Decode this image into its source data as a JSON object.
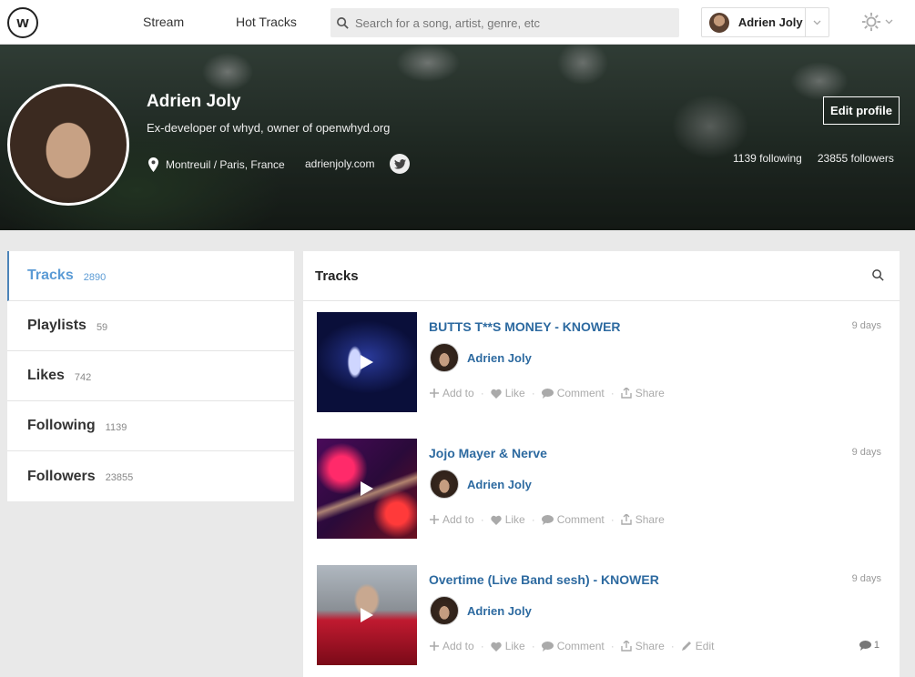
{
  "header": {
    "logo": "w",
    "nav": [
      "Stream",
      "Hot Tracks"
    ],
    "search_placeholder": "Search for a song, artist, genre, etc",
    "user_name": "Adrien Joly"
  },
  "profile": {
    "name": "Adrien Joly",
    "bio": "Ex-developer of whyd, owner of openwhyd.org",
    "location": "Montreuil / Paris, France",
    "website": "adrienjoly.com",
    "edit_label": "Edit profile",
    "following": "1139 following",
    "followers": "23855 followers"
  },
  "sidebar": {
    "items": [
      {
        "label": "Tracks",
        "count": "2890"
      },
      {
        "label": "Playlists",
        "count": "59"
      },
      {
        "label": "Likes",
        "count": "742"
      },
      {
        "label": "Following",
        "count": "1139"
      },
      {
        "label": "Followers",
        "count": "23855"
      }
    ]
  },
  "main": {
    "title": "Tracks",
    "actions": {
      "add": "Add to",
      "like": "Like",
      "comment": "Comment",
      "share": "Share",
      "edit": "Edit"
    },
    "tracks": [
      {
        "title": "BUTTS T**S MONEY - KNOWER",
        "age": "9 days",
        "user": "Adrien Joly"
      },
      {
        "title": "Jojo Mayer & Nerve",
        "age": "9 days",
        "user": "Adrien Joly"
      },
      {
        "title": "Overtime (Live Band sesh) - KNOWER",
        "age": "9 days",
        "user": "Adrien Joly",
        "comments": "1"
      }
    ]
  },
  "colors": {
    "accent": "#2d6aa0",
    "active": "#5b9bd5"
  }
}
